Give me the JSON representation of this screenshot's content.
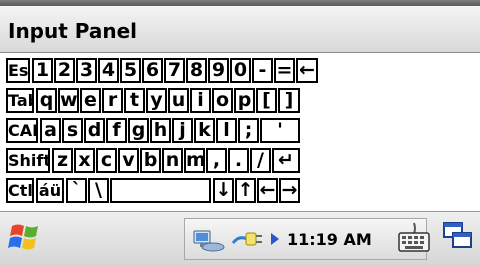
{
  "window": {
    "title": "Input Panel"
  },
  "keyboard": {
    "rows": [
      [
        "Esc",
        "1",
        "2",
        "3",
        "4",
        "5",
        "6",
        "7",
        "8",
        "9",
        "0",
        "-",
        "=",
        "←"
      ],
      [
        "Tab",
        "q",
        "w",
        "e",
        "r",
        "t",
        "y",
        "u",
        "i",
        "o",
        "p",
        "[",
        "]"
      ],
      [
        "CAP",
        "a",
        "s",
        "d",
        "f",
        "g",
        "h",
        "j",
        "k",
        "l",
        ";",
        "'"
      ],
      [
        "Shift",
        "z",
        "x",
        "c",
        "v",
        "b",
        "n",
        "m",
        ",",
        ".",
        "/",
        "↵"
      ],
      [
        "Ctl",
        "áü",
        "`",
        "\\",
        "",
        "↓",
        "↑",
        "←",
        "→"
      ]
    ]
  },
  "taskbar": {
    "start_icon": "windows-flag-icon",
    "tray_icons": [
      "network-icon",
      "power-plug-icon",
      "tray-expand-arrow-icon"
    ],
    "clock": "11:19 AM",
    "input_panel_icon": "keyboard-icon",
    "desktop_icon": "show-desktop-icon"
  }
}
